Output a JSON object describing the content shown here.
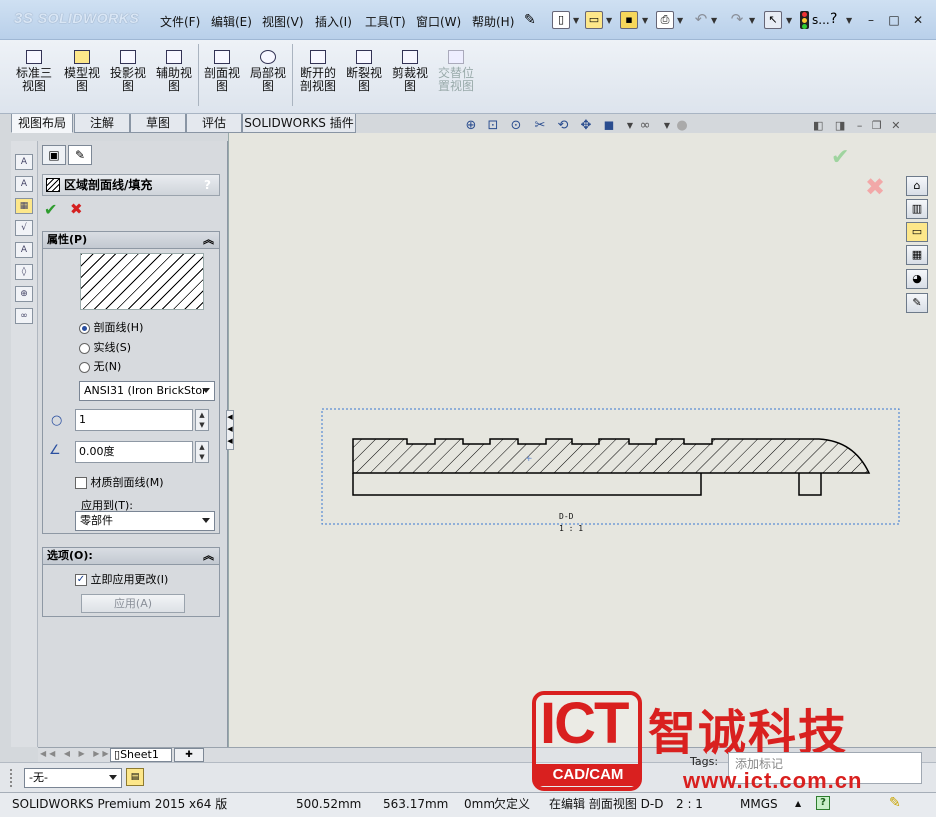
{
  "app": {
    "logo": "SOLIDWORKS",
    "logo_prefix": "3S"
  },
  "menu": [
    {
      "label": "文件(F)"
    },
    {
      "label": "编辑(E)"
    },
    {
      "label": "视图(V)"
    },
    {
      "label": "插入(I)"
    },
    {
      "label": "工具(T)"
    },
    {
      "label": "窗口(W)"
    },
    {
      "label": "帮助(H)"
    }
  ],
  "toolbar_extra": {
    "search_label": "s..."
  },
  "commands": [
    {
      "label": "标准三视图"
    },
    {
      "label": "模型视图"
    },
    {
      "label": "投影视图"
    },
    {
      "label": "辅助视图"
    },
    {
      "label": "剖面视图"
    },
    {
      "label": "局部视图"
    },
    {
      "label": "断开的剖视图"
    },
    {
      "label": "断裂视图"
    },
    {
      "label": "剪裁视图"
    },
    {
      "label": "交替位置视图"
    }
  ],
  "tabs": [
    {
      "label": "视图布局",
      "active": true
    },
    {
      "label": "注解"
    },
    {
      "label": "草图"
    },
    {
      "label": "评估"
    },
    {
      "label": "SOLIDWORKS 插件"
    }
  ],
  "property_manager": {
    "title": "区域剖面线/填充",
    "help": "?",
    "ok": "✔",
    "cancel": "✖",
    "properties": {
      "title": "属性(P)",
      "options": [
        {
          "label": "剖面线(H)",
          "selected": true
        },
        {
          "label": "实线(S)",
          "selected": false
        },
        {
          "label": "无(N)",
          "selected": false
        }
      ],
      "pattern": "ANSI31 (Iron BrickStor",
      "scale": "1",
      "angle": "0.00度",
      "material_crosshatch": "材质剖面线(M)",
      "apply_to_label": "应用到(T):",
      "apply_to": "零部件"
    },
    "options_group": {
      "title": "选项(O):",
      "apply_immediately": "立即应用更改(I)",
      "apply_button": "应用(A)"
    }
  },
  "drawing": {
    "view_label_top": "D-D",
    "view_label_bottom": "1 : 1"
  },
  "sheet": {
    "tab": "Sheet1"
  },
  "bottom": {
    "layer": "-无-",
    "tags_label": "Tags:",
    "tags_placeholder": "添加标记"
  },
  "status": {
    "product": "SOLIDWORKS Premium 2015 x64 版",
    "x": "500.52mm",
    "y": "563.17mm",
    "z": "0mm",
    "define": "欠定义",
    "editing": "在编辑 剖面视图 D-D",
    "scale": "2 : 1",
    "units": "MMGS"
  },
  "watermark": {
    "ict": "ICT",
    "cadcam": "CAD/CAM",
    "name": "智诚科技",
    "url": "www.ict.com.cn"
  },
  "colors": {
    "accent": "#2a4fa0",
    "ok_green": "#2e9c2e",
    "cancel_red": "#d42020",
    "watermark_red": "#d9201f",
    "graphics_bg": "#e6e6df"
  }
}
